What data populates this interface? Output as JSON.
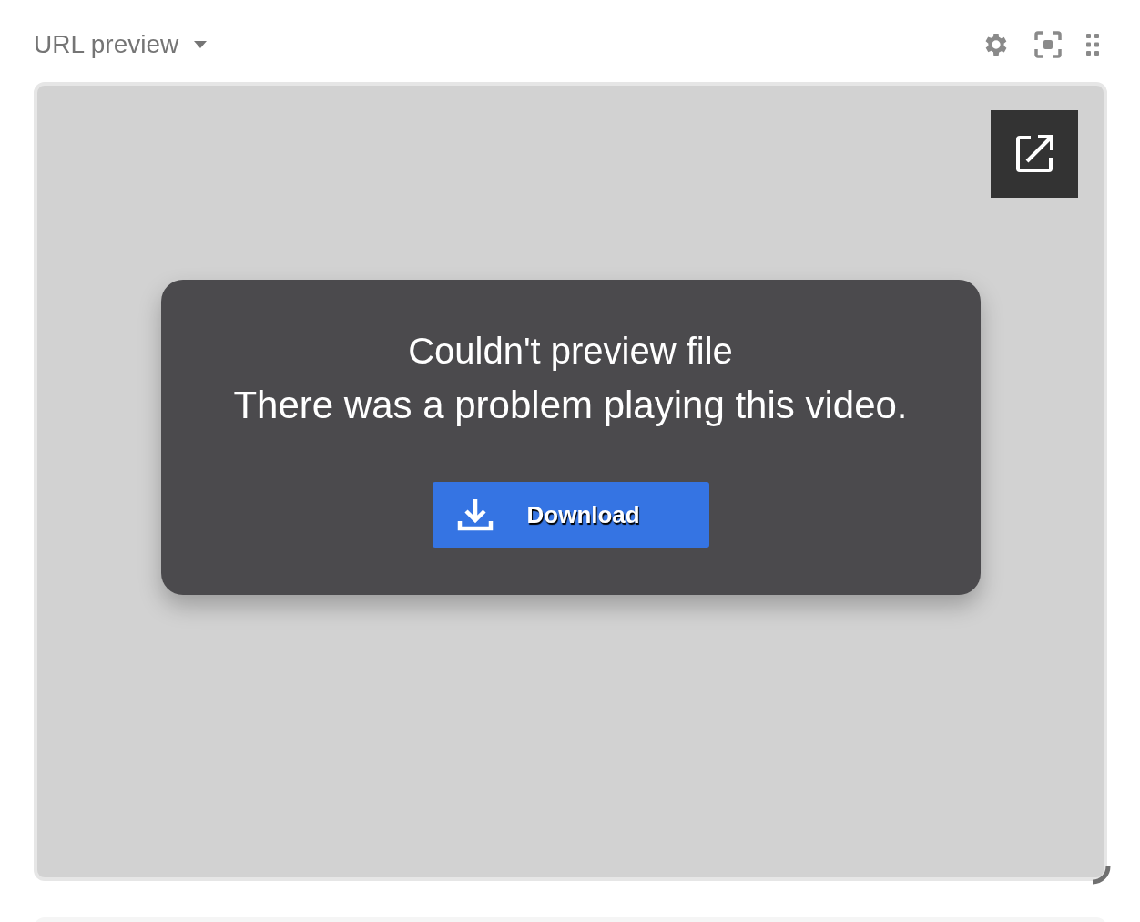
{
  "widget": {
    "title": "URL preview"
  },
  "preview": {
    "error_title": "Couldn't preview file",
    "error_message": "There was a problem playing this video.",
    "download_button": "Download"
  }
}
